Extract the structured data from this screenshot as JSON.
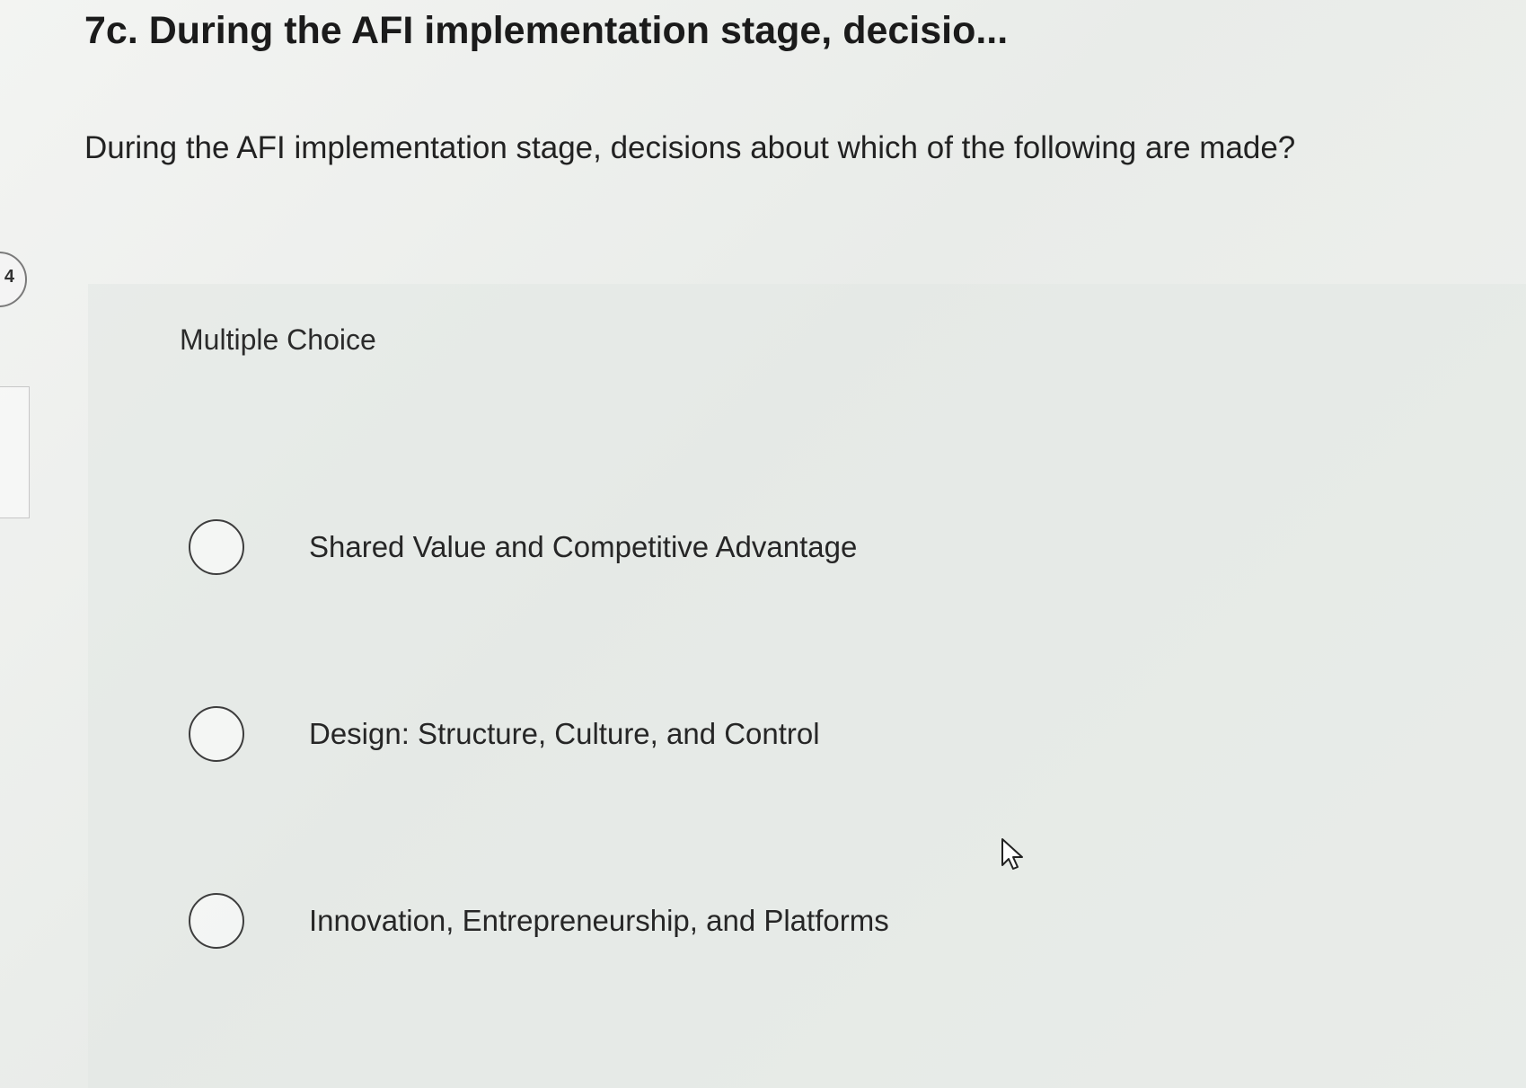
{
  "question": {
    "title": "7c. During the AFI implementation stage, decisio...",
    "prompt": "During the AFI implementation stage, decisions about which of the following are made?",
    "type_label": "Multiple Choice",
    "options": [
      {
        "label": "Shared Value and Competitive Advantage",
        "selected": false
      },
      {
        "label": "Design: Structure, Culture, and Control",
        "selected": false
      },
      {
        "label": "Innovation, Entrepreneurship, and Platforms",
        "selected": false
      }
    ]
  },
  "sidebar": {
    "badge_number": "4"
  },
  "icons": {
    "radio": "radio-unselected-icon",
    "cursor": "mouse-pointer-icon"
  }
}
